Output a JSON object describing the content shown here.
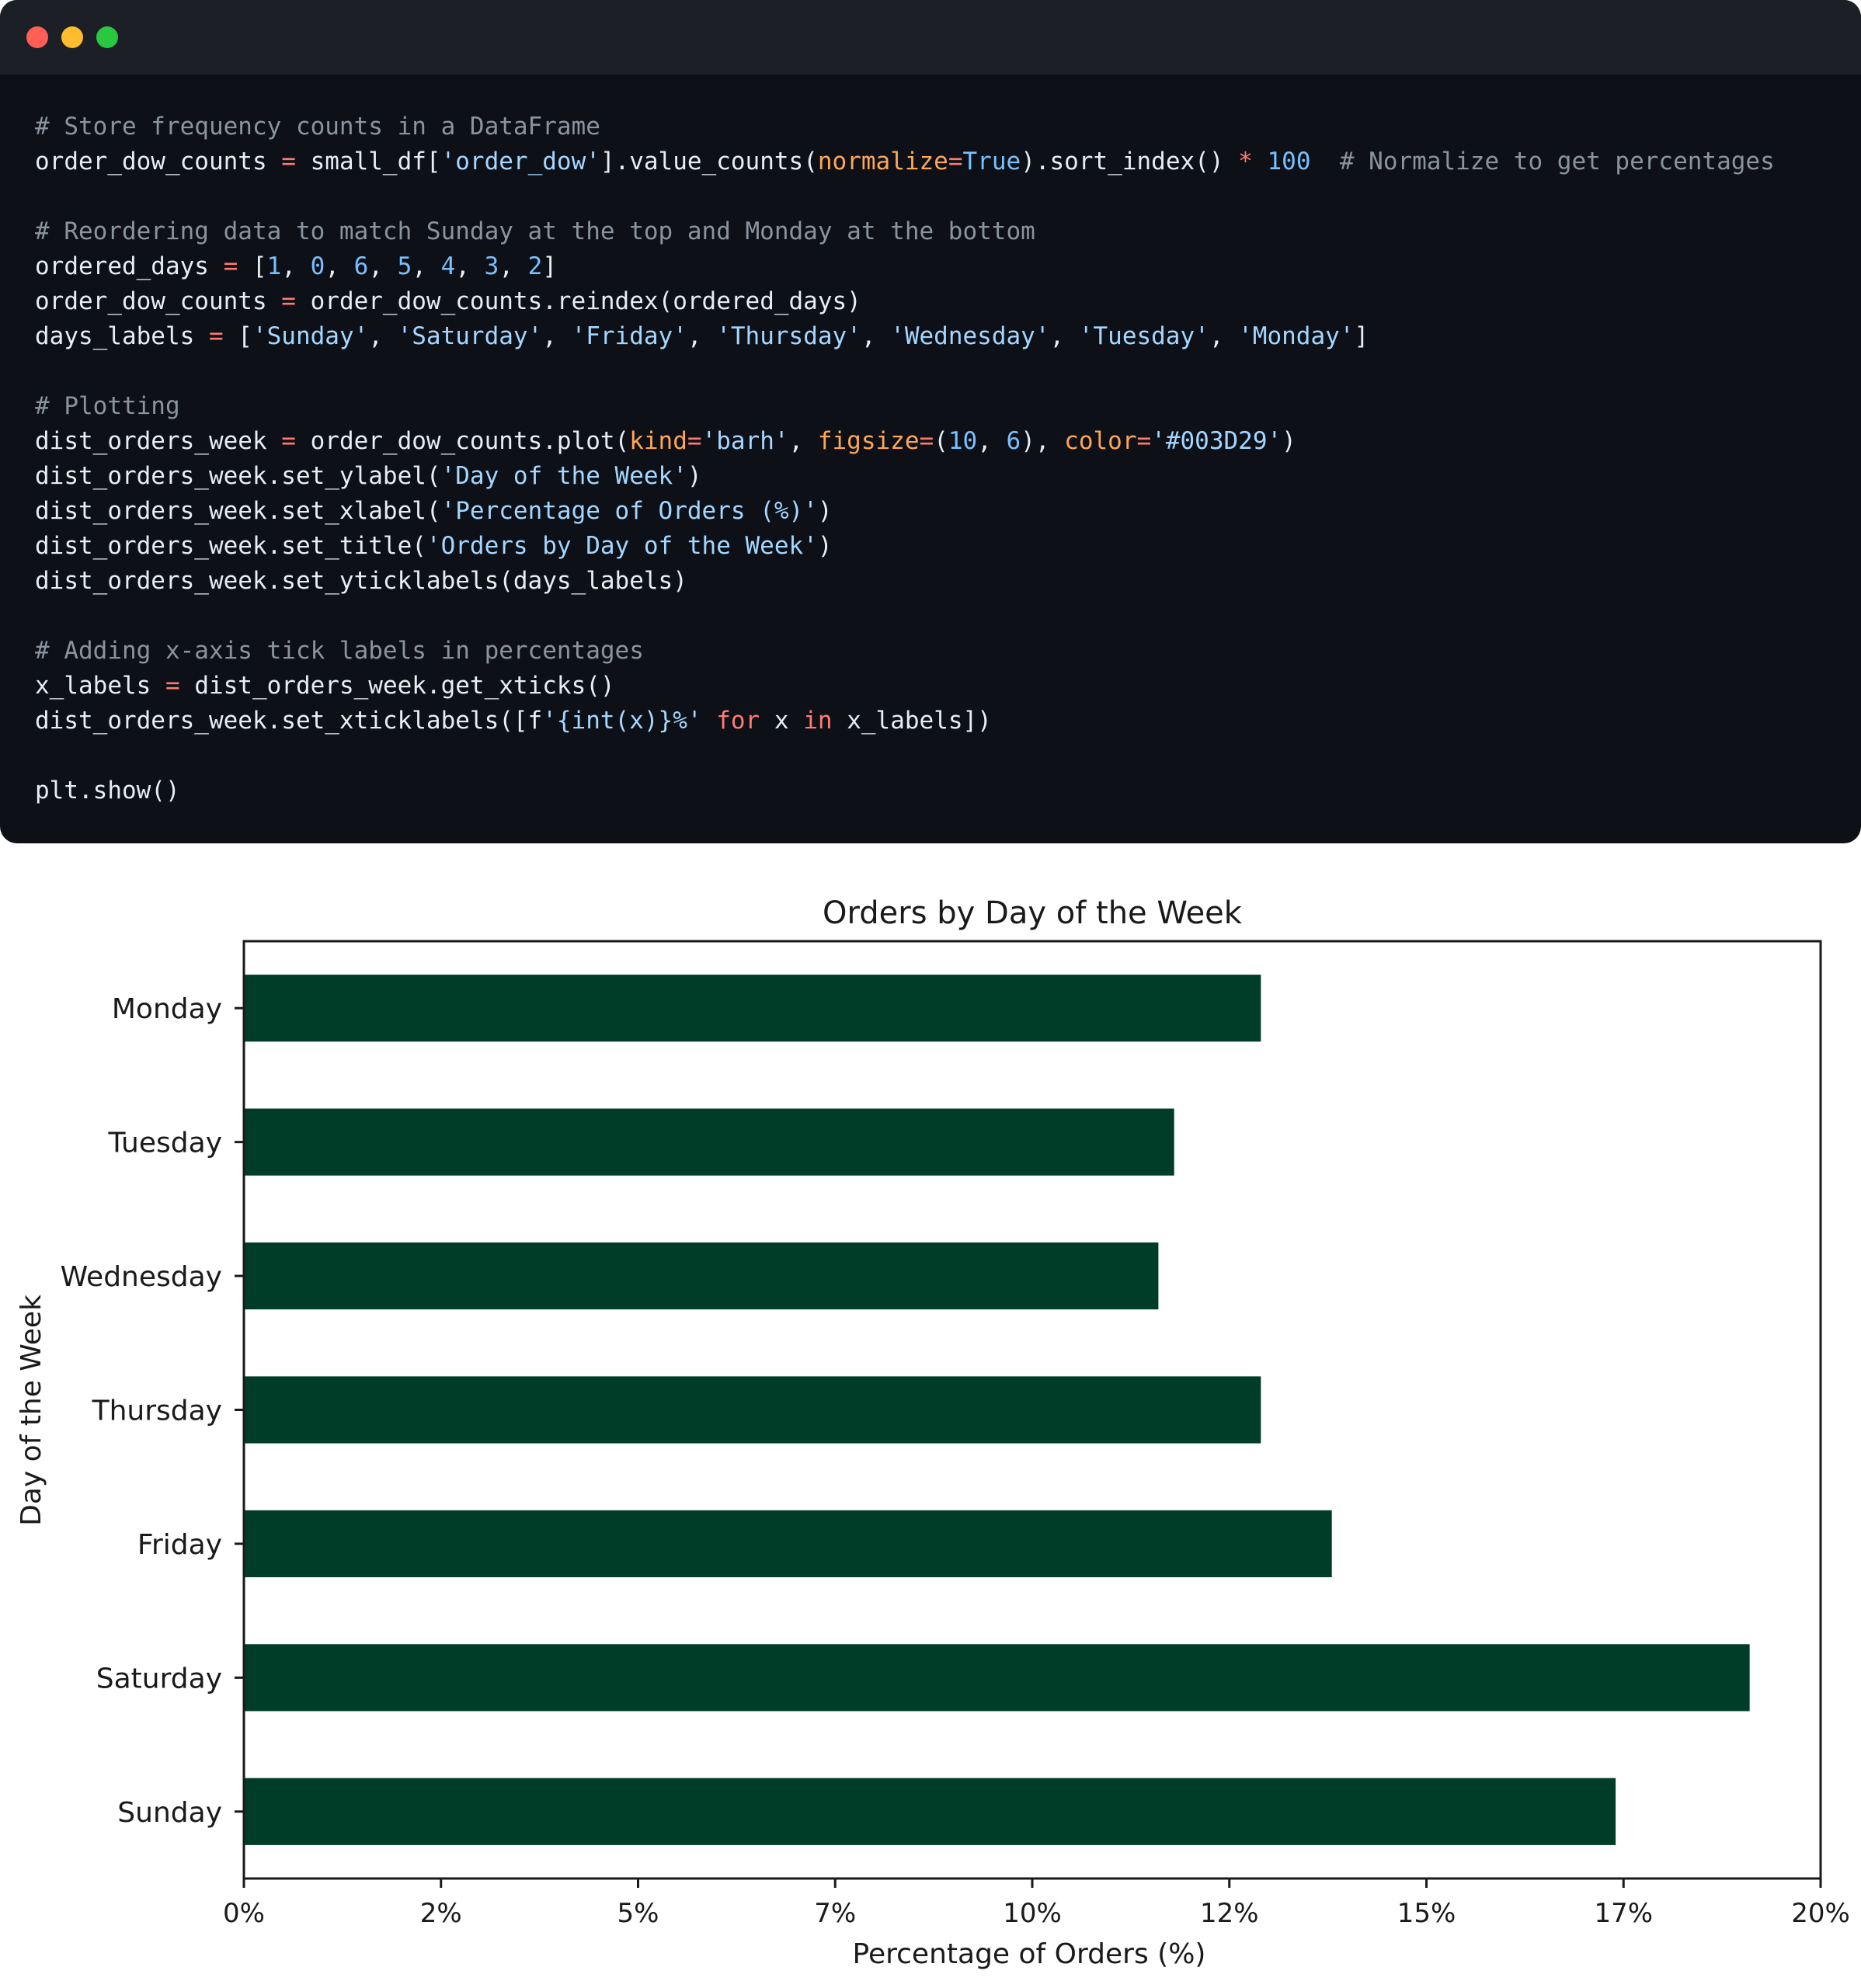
{
  "window": {
    "controls": [
      "close",
      "minimize",
      "maximize"
    ],
    "colors": {
      "close": "#ff5f57",
      "minimize": "#febc2e",
      "maximize": "#28c840",
      "background": "#0d1117",
      "titlebar": "#1c1f26"
    }
  },
  "code": {
    "lines": [
      [
        {
          "t": "comment",
          "v": "# Store frequency counts in a DataFrame"
        }
      ],
      [
        {
          "t": "plain",
          "v": "order_dow_counts "
        },
        {
          "t": "op",
          "v": "="
        },
        {
          "t": "plain",
          "v": " small_df["
        },
        {
          "t": "string",
          "v": "'order_dow'"
        },
        {
          "t": "plain",
          "v": "].value_counts("
        },
        {
          "t": "param",
          "v": "normalize"
        },
        {
          "t": "op",
          "v": "="
        },
        {
          "t": "const",
          "v": "True"
        },
        {
          "t": "plain",
          "v": ").sort_index() "
        },
        {
          "t": "op",
          "v": "*"
        },
        {
          "t": "plain",
          "v": " "
        },
        {
          "t": "number",
          "v": "100"
        },
        {
          "t": "plain",
          "v": "  "
        },
        {
          "t": "comment",
          "v": "# Normalize to get percentages"
        }
      ],
      [],
      [
        {
          "t": "comment",
          "v": "# Reordering data to match Sunday at the top and Monday at the bottom"
        }
      ],
      [
        {
          "t": "plain",
          "v": "ordered_days "
        },
        {
          "t": "op",
          "v": "="
        },
        {
          "t": "plain",
          "v": " ["
        },
        {
          "t": "number",
          "v": "1"
        },
        {
          "t": "plain",
          "v": ", "
        },
        {
          "t": "number",
          "v": "0"
        },
        {
          "t": "plain",
          "v": ", "
        },
        {
          "t": "number",
          "v": "6"
        },
        {
          "t": "plain",
          "v": ", "
        },
        {
          "t": "number",
          "v": "5"
        },
        {
          "t": "plain",
          "v": ", "
        },
        {
          "t": "number",
          "v": "4"
        },
        {
          "t": "plain",
          "v": ", "
        },
        {
          "t": "number",
          "v": "3"
        },
        {
          "t": "plain",
          "v": ", "
        },
        {
          "t": "number",
          "v": "2"
        },
        {
          "t": "plain",
          "v": "]"
        }
      ],
      [
        {
          "t": "plain",
          "v": "order_dow_counts "
        },
        {
          "t": "op",
          "v": "="
        },
        {
          "t": "plain",
          "v": " order_dow_counts.reindex(ordered_days)"
        }
      ],
      [
        {
          "t": "plain",
          "v": "days_labels "
        },
        {
          "t": "op",
          "v": "="
        },
        {
          "t": "plain",
          "v": " ["
        },
        {
          "t": "string",
          "v": "'Sunday'"
        },
        {
          "t": "plain",
          "v": ", "
        },
        {
          "t": "string",
          "v": "'Saturday'"
        },
        {
          "t": "plain",
          "v": ", "
        },
        {
          "t": "string",
          "v": "'Friday'"
        },
        {
          "t": "plain",
          "v": ", "
        },
        {
          "t": "string",
          "v": "'Thursday'"
        },
        {
          "t": "plain",
          "v": ", "
        },
        {
          "t": "string",
          "v": "'Wednesday'"
        },
        {
          "t": "plain",
          "v": ", "
        },
        {
          "t": "string",
          "v": "'Tuesday'"
        },
        {
          "t": "plain",
          "v": ", "
        },
        {
          "t": "string",
          "v": "'Monday'"
        },
        {
          "t": "plain",
          "v": "]"
        }
      ],
      [],
      [
        {
          "t": "comment",
          "v": "# Plotting"
        }
      ],
      [
        {
          "t": "plain",
          "v": "dist_orders_week "
        },
        {
          "t": "op",
          "v": "="
        },
        {
          "t": "plain",
          "v": " order_dow_counts.plot("
        },
        {
          "t": "param",
          "v": "kind"
        },
        {
          "t": "op",
          "v": "="
        },
        {
          "t": "string",
          "v": "'barh'"
        },
        {
          "t": "plain",
          "v": ", "
        },
        {
          "t": "param",
          "v": "figsize"
        },
        {
          "t": "op",
          "v": "="
        },
        {
          "t": "plain",
          "v": "("
        },
        {
          "t": "number",
          "v": "10"
        },
        {
          "t": "plain",
          "v": ", "
        },
        {
          "t": "number",
          "v": "6"
        },
        {
          "t": "plain",
          "v": "), "
        },
        {
          "t": "param",
          "v": "color"
        },
        {
          "t": "op",
          "v": "="
        },
        {
          "t": "string",
          "v": "'#003D29'"
        },
        {
          "t": "plain",
          "v": ")"
        }
      ],
      [
        {
          "t": "plain",
          "v": "dist_orders_week.set_ylabel("
        },
        {
          "t": "string",
          "v": "'Day of the Week'"
        },
        {
          "t": "plain",
          "v": ")"
        }
      ],
      [
        {
          "t": "plain",
          "v": "dist_orders_week.set_xlabel("
        },
        {
          "t": "string",
          "v": "'Percentage of Orders (%)'"
        },
        {
          "t": "plain",
          "v": ")"
        }
      ],
      [
        {
          "t": "plain",
          "v": "dist_orders_week.set_title("
        },
        {
          "t": "string",
          "v": "'Orders by Day of the Week'"
        },
        {
          "t": "plain",
          "v": ")"
        }
      ],
      [
        {
          "t": "plain",
          "v": "dist_orders_week.set_yticklabels(days_labels)"
        }
      ],
      [],
      [
        {
          "t": "comment",
          "v": "# Adding x-axis tick labels in percentages"
        }
      ],
      [
        {
          "t": "plain",
          "v": "x_labels "
        },
        {
          "t": "op",
          "v": "="
        },
        {
          "t": "plain",
          "v": " dist_orders_week.get_xticks()"
        }
      ],
      [
        {
          "t": "plain",
          "v": "dist_orders_week.set_xticklabels([f"
        },
        {
          "t": "string",
          "v": "'{int(x)}%'"
        },
        {
          "t": "plain",
          "v": " "
        },
        {
          "t": "kw",
          "v": "for"
        },
        {
          "t": "plain",
          "v": " x "
        },
        {
          "t": "kw",
          "v": "in"
        },
        {
          "t": "plain",
          "v": " x_labels])"
        }
      ],
      [],
      [
        {
          "t": "plain",
          "v": "plt.show()"
        }
      ]
    ]
  },
  "chart_data": {
    "type": "bar",
    "orientation": "horizontal",
    "title": "Orders by Day of the Week",
    "xlabel": "Percentage of Orders (%)",
    "ylabel": "Day of the Week",
    "categories": [
      "Monday",
      "Tuesday",
      "Wednesday",
      "Thursday",
      "Friday",
      "Saturday",
      "Sunday"
    ],
    "values": [
      12.9,
      11.8,
      11.6,
      12.9,
      13.8,
      19.1,
      17.4
    ],
    "xlim": [
      0,
      20
    ],
    "xticks": [
      0,
      2.5,
      5,
      7.5,
      10,
      12.5,
      15,
      17.5,
      20
    ],
    "xtick_labels": [
      "0%",
      "2%",
      "5%",
      "7%",
      "10%",
      "12%",
      "15%",
      "17%",
      "20%"
    ],
    "bar_color": "#003D29",
    "grid": false,
    "legend": false
  }
}
